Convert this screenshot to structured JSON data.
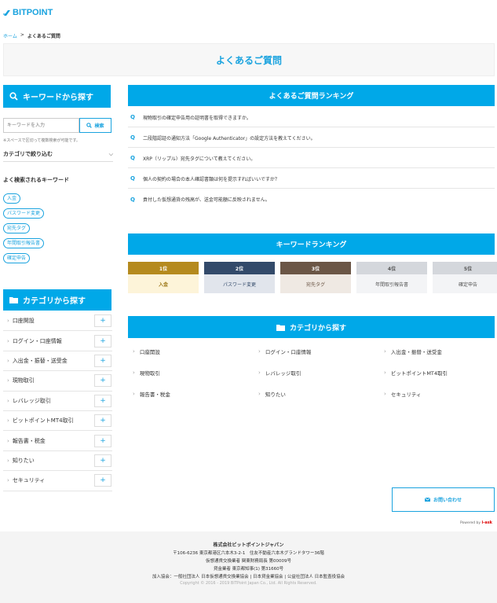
{
  "header": {
    "logo_text": "BITPOINT"
  },
  "breadcrumb": {
    "home": "ホーム",
    "separator": ">",
    "current": "よくあるご質問"
  },
  "page_title": "よくあるご質問",
  "sidebar": {
    "keyword_search": {
      "title": "キーワードから探す",
      "placeholder": "キーワードを入力",
      "button_label": "検索",
      "note": "※スペースで区切って複数検索が可能です。",
      "category_filter_label": "カテゴリで絞り込む"
    },
    "frequent_keywords": {
      "title": "よく検索されるキーワード",
      "tags": [
        "入金",
        "パスワード変更",
        "宛先タグ",
        "年間取引報告書",
        "確定申告"
      ]
    },
    "categories": {
      "title": "カテゴリから探す",
      "items": [
        "口座開設",
        "ログイン・口座情報",
        "入出金・振替・送受金",
        "現物取引",
        "レバレッジ取引",
        "ビットポイントMT4取引",
        "報告書・税金",
        "知りたい",
        "セキュリティ"
      ]
    }
  },
  "faq_ranking": {
    "title": "よくあるご質問ランキング",
    "q_label": "Q",
    "items": [
      "現物取引の確定申告用の証明書を取得できますか。",
      "二段階認証の通知方法「Google Authenticator」の設定方法を教えてください。",
      "XRP（リップル）宛先タグについて教えてください。",
      "個人の契約の場合の本人確認書類は何を提示すればいいですか？",
      "貢付した仮想通貨の残高が、送金可能額に反映されません。"
    ]
  },
  "keyword_ranking": {
    "title": "キーワードランキング",
    "items": [
      {
        "rank": "1位",
        "keyword": "入金",
        "top_color": "#b58a1e",
        "bottom_color": "#fdf4d9"
      },
      {
        "rank": "2位",
        "keyword": "パスワード変更",
        "top_color": "#334a6a",
        "bottom_color": "#e1e5ec"
      },
      {
        "rank": "3位",
        "keyword": "宛先タグ",
        "top_color": "#6b5646",
        "bottom_color": "#efe9e3"
      },
      {
        "rank": "4位",
        "keyword": "年間取引報告書",
        "top_color": "#d4d7dc",
        "bottom_color": "#f3f4f6"
      },
      {
        "rank": "5位",
        "keyword": "確定申告",
        "top_color": "#d4d7dc",
        "bottom_color": "#f3f4f6"
      }
    ]
  },
  "main_categories": {
    "title": "カテゴリから探す",
    "items": [
      "口座開設",
      "ログイン・口座情報",
      "入出金・振替・送受金",
      "現物取引",
      "レバレッジ取引",
      "ビットポイントMT4取引",
      "報告書・税金",
      "知りたい",
      "セキュリティ"
    ]
  },
  "contact_button": "お問い合わせ",
  "powered_by": {
    "prefix": "Powered by",
    "brand": "i-ask"
  },
  "footer": {
    "company": "株式会社ビットポイントジャパン",
    "address": "〒106-6236 東京都港区六本木3-2-1　住友不動産六本木グランドタワー36階",
    "line2": "仮想通貨交換業者 関東財務局長 第00009号",
    "line3": "貸金業者 東京都知事(1) 第31660号",
    "line4": "加入協会：一般社団法人 日本仮想通貨交換業協会 | 日本貸金業協会 | 公益社団法人 日本監査役協会",
    "copyright": "Copyright © 2016 - 2019 BITPoint Japan Co., Ltd. All Rights Reserved."
  },
  "colors": {
    "accent": "#00a8e8"
  }
}
